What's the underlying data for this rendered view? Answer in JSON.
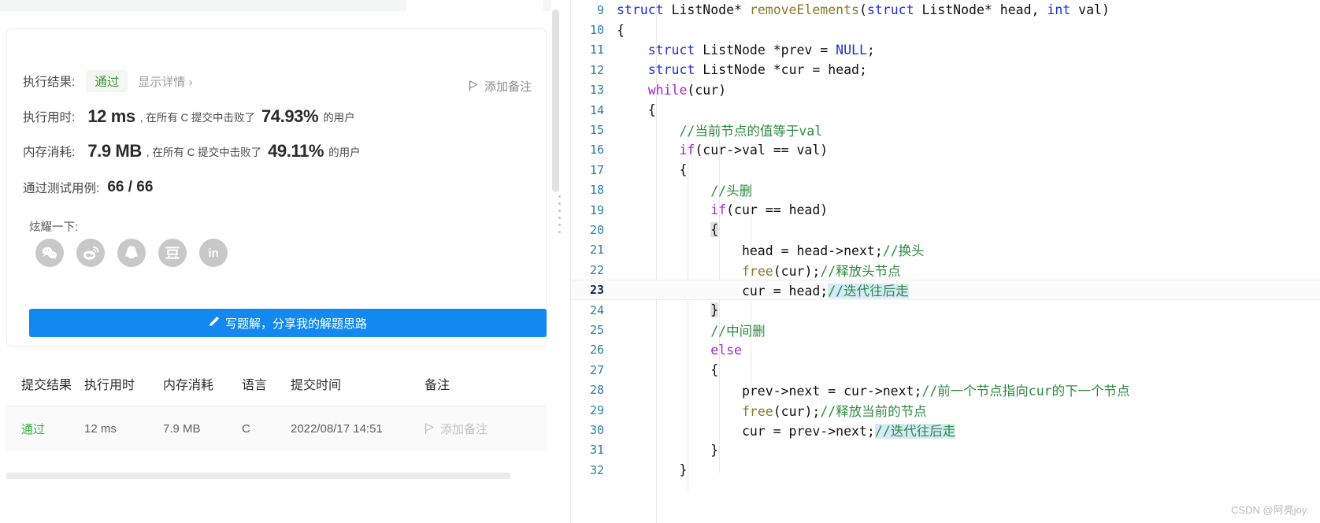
{
  "left_panel": {
    "result_label": "执行结果:",
    "result_badge": "通过",
    "detail_link": "显示详情 ›",
    "add_note_top": "添加备注",
    "runtime_label": "执行用时:",
    "runtime_value": "12 ms",
    "runtime_prefix": ", 在所有 C 提交中击败了",
    "runtime_percent": "74.93%",
    "runtime_suffix": "的用户",
    "memory_label": "内存消耗:",
    "memory_value": "7.9 MB",
    "memory_prefix": ", 在所有 C 提交中击败了",
    "memory_percent": "49.11%",
    "memory_suffix": "的用户",
    "cases_label": "通过测试用例:",
    "cases_value": "66 / 66",
    "share_label": "炫耀一下:",
    "share_icons": [
      {
        "name": "wechat-icon",
        "glyph": "Ⓦ"
      },
      {
        "name": "weibo-icon",
        "glyph": "Ⓦ"
      },
      {
        "name": "qq-icon",
        "glyph": "Ⓦ"
      },
      {
        "name": "douban-icon",
        "glyph": "豆"
      },
      {
        "name": "linkedin-icon",
        "glyph": "in"
      }
    ],
    "solution_button": "写题解，分享我的解题思路",
    "accent_color": "#1389f0",
    "pass_color": "#3fab47"
  },
  "table": {
    "headers": [
      "提交结果",
      "执行用时",
      "内存消耗",
      "语言",
      "提交时间",
      "备注"
    ],
    "rows": [
      {
        "result": "通过",
        "runtime": "12 ms",
        "memory": "7.9 MB",
        "language": "C",
        "time": "2022/08/17 14:51",
        "note": "添加备注"
      }
    ]
  },
  "editor": {
    "watermark": "CSDN @阿亮joy.",
    "current_line": 23,
    "lines": [
      {
        "n": 9,
        "html": "<span class='typ'>struct</span> ListNode* <span class='fn'>removeElements</span>(<span class='typ'>struct</span> ListNode* head, <span class='typ'>int</span> val)"
      },
      {
        "n": 10,
        "html": "{"
      },
      {
        "n": 11,
        "html": "    <span class='typ'>struct</span> ListNode *prev = <span class='typ'>NULL</span>;"
      },
      {
        "n": 12,
        "html": "    <span class='typ'>struct</span> ListNode *cur = head;"
      },
      {
        "n": 13,
        "html": "    <span class='kw'>while</span>(cur)"
      },
      {
        "n": 14,
        "html": "    {"
      },
      {
        "n": 15,
        "html": "        <span class='cmt'>//当前节点的值等于val</span>"
      },
      {
        "n": 16,
        "html": "        <span class='kw'>if</span>(cur-&gt;val == val)"
      },
      {
        "n": 17,
        "html": "        {"
      },
      {
        "n": 18,
        "html": "            <span class='cmt'>//头删</span>"
      },
      {
        "n": 19,
        "html": "            <span class='kw'>if</span>(cur == head)"
      },
      {
        "n": 20,
        "html": "            <span class='brk'>{</span>"
      },
      {
        "n": 21,
        "html": "                head = head-&gt;next;<span class='cmt'>//换头</span>"
      },
      {
        "n": 22,
        "html": "                <span class='fn'>free</span>(cur);<span class='cmt'>//释放头节点</span>"
      },
      {
        "n": 23,
        "html": "                cur = head;<span class='cmt sel'>//迭代往后走</span>"
      },
      {
        "n": 24,
        "html": "            <span class='brk'>}</span>"
      },
      {
        "n": 25,
        "html": "            <span class='cmt'>//中间删</span>"
      },
      {
        "n": 26,
        "html": "            <span class='kw'>else</span>"
      },
      {
        "n": 27,
        "html": "            {"
      },
      {
        "n": 28,
        "html": "                prev-&gt;next = cur-&gt;next;<span class='cmt'>//前一个节点指向cur的下一个节点</span>"
      },
      {
        "n": 29,
        "html": "                <span class='fn'>free</span>(cur);<span class='cmt'>//释放当前的节点</span>"
      },
      {
        "n": 30,
        "html": "                cur = prev-&gt;next;<span class='cmt sel'>//迭代往后走</span>"
      },
      {
        "n": 31,
        "html": "            }"
      },
      {
        "n": 32,
        "html": "        }"
      }
    ]
  }
}
